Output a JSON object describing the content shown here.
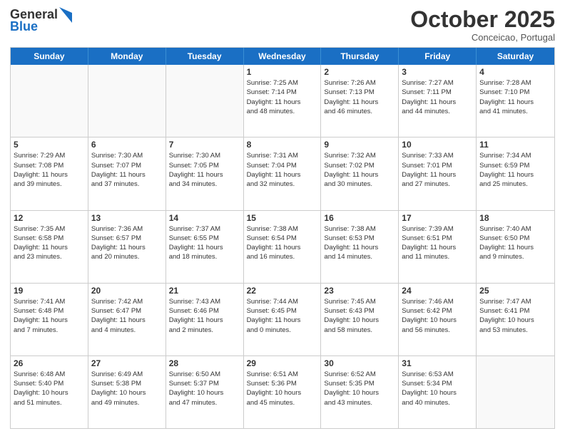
{
  "header": {
    "logo_general": "General",
    "logo_blue": "Blue",
    "month_title": "October 2025",
    "subtitle": "Conceicao, Portugal"
  },
  "days_of_week": [
    "Sunday",
    "Monday",
    "Tuesday",
    "Wednesday",
    "Thursday",
    "Friday",
    "Saturday"
  ],
  "weeks": [
    [
      {
        "day": "",
        "info": ""
      },
      {
        "day": "",
        "info": ""
      },
      {
        "day": "",
        "info": ""
      },
      {
        "day": "1",
        "info": "Sunrise: 7:25 AM\nSunset: 7:14 PM\nDaylight: 11 hours\nand 48 minutes."
      },
      {
        "day": "2",
        "info": "Sunrise: 7:26 AM\nSunset: 7:13 PM\nDaylight: 11 hours\nand 46 minutes."
      },
      {
        "day": "3",
        "info": "Sunrise: 7:27 AM\nSunset: 7:11 PM\nDaylight: 11 hours\nand 44 minutes."
      },
      {
        "day": "4",
        "info": "Sunrise: 7:28 AM\nSunset: 7:10 PM\nDaylight: 11 hours\nand 41 minutes."
      }
    ],
    [
      {
        "day": "5",
        "info": "Sunrise: 7:29 AM\nSunset: 7:08 PM\nDaylight: 11 hours\nand 39 minutes."
      },
      {
        "day": "6",
        "info": "Sunrise: 7:30 AM\nSunset: 7:07 PM\nDaylight: 11 hours\nand 37 minutes."
      },
      {
        "day": "7",
        "info": "Sunrise: 7:30 AM\nSunset: 7:05 PM\nDaylight: 11 hours\nand 34 minutes."
      },
      {
        "day": "8",
        "info": "Sunrise: 7:31 AM\nSunset: 7:04 PM\nDaylight: 11 hours\nand 32 minutes."
      },
      {
        "day": "9",
        "info": "Sunrise: 7:32 AM\nSunset: 7:02 PM\nDaylight: 11 hours\nand 30 minutes."
      },
      {
        "day": "10",
        "info": "Sunrise: 7:33 AM\nSunset: 7:01 PM\nDaylight: 11 hours\nand 27 minutes."
      },
      {
        "day": "11",
        "info": "Sunrise: 7:34 AM\nSunset: 6:59 PM\nDaylight: 11 hours\nand 25 minutes."
      }
    ],
    [
      {
        "day": "12",
        "info": "Sunrise: 7:35 AM\nSunset: 6:58 PM\nDaylight: 11 hours\nand 23 minutes."
      },
      {
        "day": "13",
        "info": "Sunrise: 7:36 AM\nSunset: 6:57 PM\nDaylight: 11 hours\nand 20 minutes."
      },
      {
        "day": "14",
        "info": "Sunrise: 7:37 AM\nSunset: 6:55 PM\nDaylight: 11 hours\nand 18 minutes."
      },
      {
        "day": "15",
        "info": "Sunrise: 7:38 AM\nSunset: 6:54 PM\nDaylight: 11 hours\nand 16 minutes."
      },
      {
        "day": "16",
        "info": "Sunrise: 7:38 AM\nSunset: 6:53 PM\nDaylight: 11 hours\nand 14 minutes."
      },
      {
        "day": "17",
        "info": "Sunrise: 7:39 AM\nSunset: 6:51 PM\nDaylight: 11 hours\nand 11 minutes."
      },
      {
        "day": "18",
        "info": "Sunrise: 7:40 AM\nSunset: 6:50 PM\nDaylight: 11 hours\nand 9 minutes."
      }
    ],
    [
      {
        "day": "19",
        "info": "Sunrise: 7:41 AM\nSunset: 6:48 PM\nDaylight: 11 hours\nand 7 minutes."
      },
      {
        "day": "20",
        "info": "Sunrise: 7:42 AM\nSunset: 6:47 PM\nDaylight: 11 hours\nand 4 minutes."
      },
      {
        "day": "21",
        "info": "Sunrise: 7:43 AM\nSunset: 6:46 PM\nDaylight: 11 hours\nand 2 minutes."
      },
      {
        "day": "22",
        "info": "Sunrise: 7:44 AM\nSunset: 6:45 PM\nDaylight: 11 hours\nand 0 minutes."
      },
      {
        "day": "23",
        "info": "Sunrise: 7:45 AM\nSunset: 6:43 PM\nDaylight: 10 hours\nand 58 minutes."
      },
      {
        "day": "24",
        "info": "Sunrise: 7:46 AM\nSunset: 6:42 PM\nDaylight: 10 hours\nand 56 minutes."
      },
      {
        "day": "25",
        "info": "Sunrise: 7:47 AM\nSunset: 6:41 PM\nDaylight: 10 hours\nand 53 minutes."
      }
    ],
    [
      {
        "day": "26",
        "info": "Sunrise: 6:48 AM\nSunset: 5:40 PM\nDaylight: 10 hours\nand 51 minutes."
      },
      {
        "day": "27",
        "info": "Sunrise: 6:49 AM\nSunset: 5:38 PM\nDaylight: 10 hours\nand 49 minutes."
      },
      {
        "day": "28",
        "info": "Sunrise: 6:50 AM\nSunset: 5:37 PM\nDaylight: 10 hours\nand 47 minutes."
      },
      {
        "day": "29",
        "info": "Sunrise: 6:51 AM\nSunset: 5:36 PM\nDaylight: 10 hours\nand 45 minutes."
      },
      {
        "day": "30",
        "info": "Sunrise: 6:52 AM\nSunset: 5:35 PM\nDaylight: 10 hours\nand 43 minutes."
      },
      {
        "day": "31",
        "info": "Sunrise: 6:53 AM\nSunset: 5:34 PM\nDaylight: 10 hours\nand 40 minutes."
      },
      {
        "day": "",
        "info": ""
      }
    ]
  ]
}
